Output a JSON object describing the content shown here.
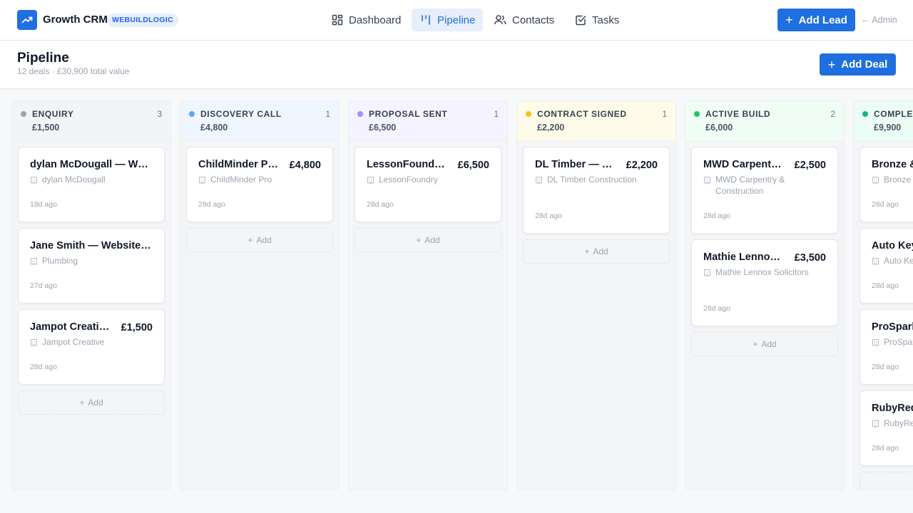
{
  "app": {
    "name": "Growth CRM",
    "org_badge": "WEBUILDLOGIC",
    "logo_icon": "trending-up-icon",
    "accent": "#1f6fe0"
  },
  "nav": {
    "items": [
      {
        "label": "Dashboard",
        "icon": "dashboard-grid-icon"
      },
      {
        "label": "Pipeline",
        "icon": "pipeline-columns-icon",
        "active": true
      },
      {
        "label": "Contacts",
        "icon": "users-icon"
      },
      {
        "label": "Tasks",
        "icon": "checkbox-icon"
      }
    ],
    "add_lead": "Add Lead",
    "admin_link": "← Admin"
  },
  "page": {
    "title": "Pipeline",
    "subtitle": "12 deals · £30,900 total value",
    "add_deal": "Add Deal"
  },
  "board": {
    "add_label": "Add",
    "columns": [
      {
        "name": "ENQUIRY",
        "count": "3",
        "total": "£1,500",
        "dot": "#9ca3af",
        "bg": "#f3f4f6",
        "cards": [
          {
            "title": "dylan McDougall — Website Enquiry",
            "value": "",
            "company": "dylan McDougall",
            "time": "18d ago"
          },
          {
            "title": "Jane Smith — Website Enquiry",
            "value": "",
            "company": "Plumbing",
            "time": "27d ago"
          },
          {
            "title": "Jampot Creative — Website",
            "value": "£1,500",
            "company": "Jampot Creative",
            "time": "28d ago"
          }
        ]
      },
      {
        "name": "DISCOVERY CALL",
        "count": "1",
        "total": "£4,800",
        "dot": "#60a5fa",
        "bg": "#eff6ff",
        "cards": [
          {
            "title": "ChildMinder Pro — Platform",
            "value": "£4,800",
            "company": "ChildMinder Pro",
            "time": "28d ago"
          }
        ]
      },
      {
        "name": "PROPOSAL SENT",
        "count": "1",
        "total": "£6,500",
        "dot": "#a78bfa",
        "bg": "#f5f3ff",
        "cards": [
          {
            "title": "LessonFoundry — Platform",
            "value": "£6,500",
            "company": "LessonFoundry",
            "time": "28d ago"
          }
        ]
      },
      {
        "name": "CONTRACT SIGNED",
        "count": "1",
        "total": "£2,200",
        "dot": "#fbbf24",
        "bg": "#fefce8",
        "cards": [
          {
            "title": "DL Timber — Construction Website",
            "value": "£2,200",
            "company": "DL Timber Construction",
            "time": "28d ago"
          }
        ]
      },
      {
        "name": "ACTIVE BUILD",
        "count": "2",
        "total": "£6,000",
        "dot": "#22c55e",
        "bg": "#f0fdf4",
        "cards": [
          {
            "title": "MWD Carpentry & Construction",
            "value": "£2,500",
            "company": "MWD Carpentry & Construction",
            "time": "28d ago"
          },
          {
            "title": "Mathie Lennox Solicitors",
            "value": "£3,500",
            "company": "Mathie Lennox Solicitors",
            "time": "28d ago"
          }
        ]
      },
      {
        "name": "COMPLETED",
        "count": "",
        "total": "£9,900",
        "dot": "#10b981",
        "bg": "#ecfdf5",
        "cards": [
          {
            "title": "Bronze & Co",
            "value": "",
            "company": "Bronze & Co",
            "time": "28d ago"
          },
          {
            "title": "Auto Keys",
            "value": "",
            "company": "Auto Keys",
            "time": "28d ago"
          },
          {
            "title": "ProSpark Electrical",
            "value": "",
            "company": "ProSpark Electrical",
            "time": "28d ago"
          },
          {
            "title": "RubyRed",
            "value": "",
            "company": "RubyRed",
            "time": "28d ago"
          }
        ]
      }
    ]
  }
}
